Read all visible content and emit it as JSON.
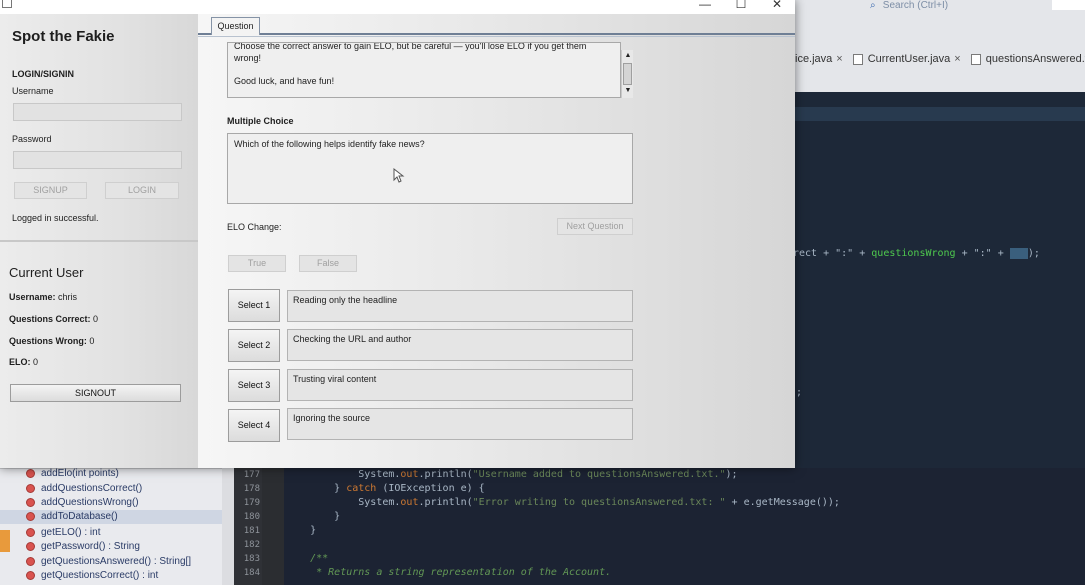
{
  "ide": {
    "search_placeholder": "Search (Ctrl+I)",
    "tabs": [
      {
        "label": "ice.java",
        "close": "×"
      },
      {
        "label": "CurrentUser.java",
        "close": "×"
      },
      {
        "label": "questionsAnswered.txt..."
      }
    ],
    "code_top": {
      "frag1": "rect + \":\" + ",
      "frag2": "questionsWrong",
      "frag3": " + \":\" + ",
      "frag4": "   ",
      "frag5": ");"
    },
    "semicolon_fragment": ";",
    "navigator": [
      "addElo(int points)",
      "addQuestionsCorrect()",
      "addQuestionsWrong()",
      "addToDatabase()",
      "getELO() : int",
      "getPassword() : String",
      "getQuestionsAnswered() : String[]",
      "getQuestionsCorrect() : int"
    ],
    "line_numbers": [
      "177",
      "178",
      "179",
      "180",
      "181",
      "182",
      "183",
      "184"
    ],
    "code_lines": [
      {
        "indent": "            ",
        "a": "System.",
        "b": "out",
        "c": ".println(",
        "d": "\"Username added to questionsAnswered.txt.\"",
        "e": ");"
      },
      {
        "indent": "        ",
        "a": "} ",
        "b": "catch",
        "c": " (IOException e) {",
        "d": "",
        "e": ""
      },
      {
        "indent": "            ",
        "a": "System.",
        "b": "out",
        "c": ".println(",
        "d": "\"Error writing to questionsAnswered.txt: \"",
        "e": " + e.getMessage());"
      },
      {
        "indent": "        ",
        "a": "}",
        "b": "",
        "c": "",
        "d": "",
        "e": ""
      },
      {
        "indent": "    ",
        "a": "}",
        "b": "",
        "c": "",
        "d": "",
        "e": ""
      },
      {
        "indent": "",
        "a": "",
        "b": "",
        "c": "",
        "d": "",
        "e": ""
      },
      {
        "indent": "    ",
        "a": "/**",
        "b": "",
        "c": "",
        "d": "",
        "e": ""
      },
      {
        "indent": "     ",
        "a": "* Returns a string representation of the Account.",
        "b": "",
        "c": "",
        "d": "",
        "e": ""
      }
    ]
  },
  "window": {
    "minimize": "—",
    "maximize": "☐",
    "close": "✕"
  },
  "login": {
    "app_title": "Spot the Fakie",
    "section_label": "LOGIN/SIGNIN",
    "username_label": "Username",
    "username_value": "",
    "password_label": "Password",
    "password_value": "",
    "signup_label": "SIGNUP",
    "login_label": "LOGIN",
    "status": "Logged in successful."
  },
  "current_user": {
    "title": "Current User",
    "username_label": "Username:",
    "username_value": "chris",
    "correct_label": "Questions Correct:",
    "correct_value": "0",
    "wrong_label": "Questions Wrong:",
    "wrong_value": "0",
    "elo_label": "ELO:",
    "elo_value": "0",
    "signout_label": "SIGNOUT"
  },
  "question_tab": {
    "tab_label": "Question",
    "intro_line1": "Choose the correct answer to gain ELO, but be careful — you'll lose ELO if you get them",
    "intro_line2": "wrong!",
    "intro_line3": "Good luck, and have fun!",
    "multiple_choice_label": "Multiple Choice",
    "question_text": "Which of the following helps identify fake news?",
    "elo_change_label": "ELO Change:",
    "next_question_label": "Next Question",
    "true_label": "True",
    "false_label": "False",
    "options": [
      {
        "button": "Select 1",
        "text": "Reading only the headline"
      },
      {
        "button": "Select 2",
        "text": "Checking the URL and author"
      },
      {
        "button": "Select 3",
        "text": "Trusting viral content"
      },
      {
        "button": "Select 4",
        "text": "Ignoring the source"
      }
    ]
  }
}
